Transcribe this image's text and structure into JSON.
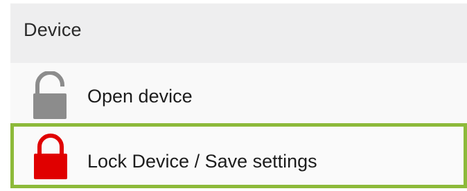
{
  "section": {
    "title": "Device"
  },
  "rows": [
    {
      "label": "Open device",
      "icon": "open-padlock-icon",
      "icon_color": "#8c8c8c"
    },
    {
      "label": "Lock Device / Save settings",
      "icon": "locked-padlock-icon",
      "icon_color": "#e00000",
      "highlight_color": "#8dba3a"
    }
  ]
}
